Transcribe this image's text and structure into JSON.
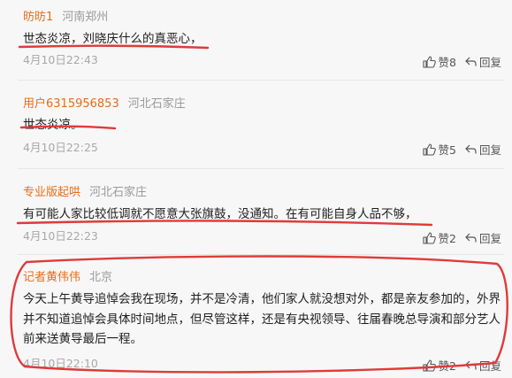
{
  "comments": [
    {
      "user": "昉昉1",
      "location": "河南郑州",
      "text": "世态炎凉，刘晓庆什么的真恶心，",
      "time": "4月10日22:43",
      "likes_label": "赞8",
      "reply_label": "回复"
    },
    {
      "user": "用户6315956853",
      "location": "河北石家庄",
      "text": "世态炎凉。",
      "time": "4月10日22:25",
      "likes_label": "赞5",
      "reply_label": "回复"
    },
    {
      "user": "专业版起哄",
      "location": "河北石家庄",
      "text": "有可能人家比较低调就不愿意大张旗鼓，没通知。在有可能自身人品不够，",
      "time": "4月10日22:23",
      "likes_label": "赞2",
      "reply_label": "回复"
    },
    {
      "user": "记者黄伟伟",
      "location": "北京",
      "text": "今天上午黄导追悼会我在现场，并不是冷清，他们家人就没想对外，都是亲友参加的，外界并不知道追悼会具体时间地点，但尽管这样，还是有央视领导、往届春晚总导演和部分艺人前来送黄导最后一程。",
      "time": "4月10日22:10",
      "likes_label": "赞2",
      "reply_label": "回复"
    }
  ],
  "icons": {
    "like": "thumbs-up-icon",
    "reply": "reply-arrow-icon"
  },
  "colors": {
    "username": "#e96b16",
    "annotation": "#e03a3a"
  }
}
